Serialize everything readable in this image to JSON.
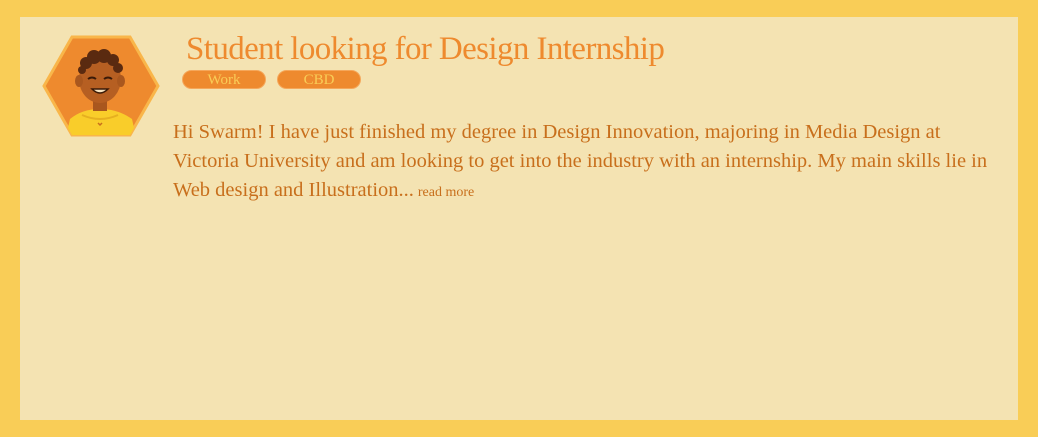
{
  "post": {
    "title": "Student looking for Design Internship",
    "tags": [
      "Work",
      "CBD"
    ],
    "description": "Hi Swarm! I have just finished my degree in Design Innovation, majoring in Media Design at Victoria University and am looking to get into the industry with an internship. My main skills lie in Web design and Illustration...",
    "read_more": "read more",
    "avatar_icon": "student-avatar-icon"
  },
  "colors": {
    "frame": "#f9cd57",
    "card": "#f4e3b2",
    "accent": "#ee8a2e",
    "text": "#c86f1c"
  }
}
